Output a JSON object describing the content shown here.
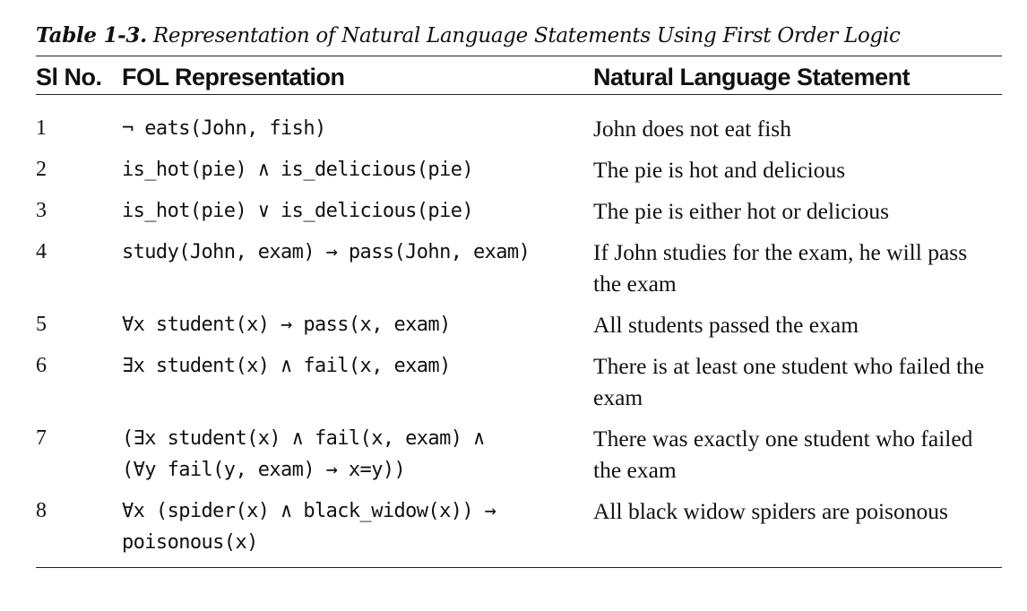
{
  "caption": {
    "label": "Table 1-3.",
    "title": "Representation of Natural Language Statements Using First Order Logic"
  },
  "table": {
    "headers": [
      "Sl No.",
      "FOL Representation",
      "Natural Language Statement"
    ],
    "rows": [
      {
        "num": "1",
        "fol": "¬ eats(John, fish)",
        "nl": "John does not eat fish"
      },
      {
        "num": "2",
        "fol": "is_hot(pie) ∧ is_delicious(pie)",
        "nl": "The pie is hot and delicious"
      },
      {
        "num": "3",
        "fol": "is_hot(pie) ∨ is_delicious(pie)",
        "nl": "The pie is either hot or delicious"
      },
      {
        "num": "4",
        "fol": "study(John, exam) → pass(John, exam)",
        "nl": "If John studies for the exam, he will pass the exam"
      },
      {
        "num": "5",
        "fol": "∀x student(x) → pass(x, exam)",
        "nl": "All students passed the exam"
      },
      {
        "num": "6",
        "fol": "∃x student(x) ∧ fail(x, exam)",
        "nl": "There is at least one student who failed the exam"
      },
      {
        "num": "7",
        "fol": "(∃x student(x) ∧ fail(x, exam) ∧\n(∀y fail(y, exam) → x=y))",
        "nl": "There was exactly one student who failed the exam"
      },
      {
        "num": "8",
        "fol": "∀x (spider(x) ∧ black_widow(x)) →\npoisonous(x)",
        "nl": "All black widow spiders are poisonous"
      }
    ]
  }
}
